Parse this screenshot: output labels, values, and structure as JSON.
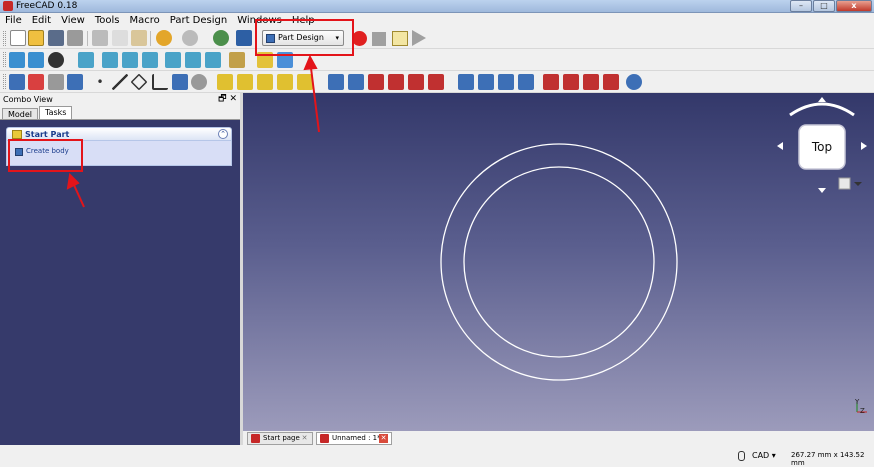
{
  "window": {
    "title": "FreeCAD 0.18",
    "minimize": "–",
    "maximize": "□",
    "close": "x"
  },
  "menu": [
    "File",
    "Edit",
    "View",
    "Tools",
    "Macro",
    "Part Design",
    "Windows",
    "Help"
  ],
  "workbench": {
    "selected": "Part Design",
    "caret": "▾"
  },
  "combo": {
    "title": "Combo View",
    "float_icon": "🗗",
    "close_icon": "✕"
  },
  "tabs": {
    "model": "Model",
    "tasks": "Tasks"
  },
  "task": {
    "title": "Start Part",
    "collapse": "⌃",
    "action": "Create body"
  },
  "navcube": {
    "face": "Top"
  },
  "axis": {
    "y": "Y",
    "z": "Z"
  },
  "view_tabs": {
    "start": "Start page",
    "unnamed": "Unnamed : 1*",
    "close": "✕"
  },
  "status": {
    "nav_style": "CAD ▾",
    "dimensions": "267.27 mm x 143.52 mm"
  },
  "colors": {
    "highlight": "#e3141a",
    "view_top": "#33386a",
    "view_bottom": "#9c9bbb",
    "task_panel": "#363a6b"
  }
}
